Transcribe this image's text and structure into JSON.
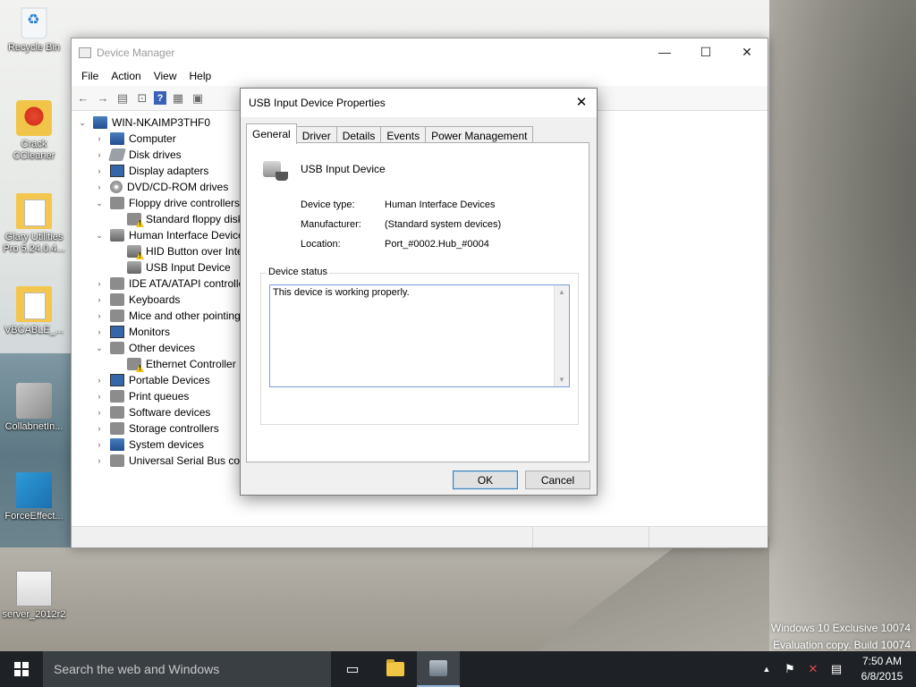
{
  "desktop": {
    "icons": [
      {
        "label": "Recycle Bin"
      },
      {
        "label": "Crack\nCCleaner"
      },
      {
        "label": "Glary Utilities\nPro 5.24.0.4..."
      },
      {
        "label": "VBCABLE_..."
      },
      {
        "label": "CollabnetIn..."
      },
      {
        "label": "ForceEffect..."
      },
      {
        "label": "server_2012r2"
      }
    ],
    "watermark": {
      "line1": "Windows 10 Exclusive 10074",
      "line2": "Evaluation copy. Build 10074"
    }
  },
  "device_manager": {
    "title": "Device Manager",
    "controls": {
      "minimize": "—",
      "maximize": "☐",
      "close": "✕"
    },
    "menu": [
      "File",
      "Action",
      "View",
      "Help"
    ],
    "toolbar": {
      "back_icon": "←",
      "forward_icon": "→",
      "props_icon": "▤",
      "scan_icon": "⊡",
      "help_icon": "?",
      "view_icon": "▦",
      "device_icon": "▣"
    },
    "tree": {
      "root": "WIN-NKAIMP3THF0",
      "items": [
        {
          "label": "Computer",
          "arrow": "›"
        },
        {
          "label": "Disk drives",
          "arrow": "›"
        },
        {
          "label": "Display adapters",
          "arrow": "›"
        },
        {
          "label": "DVD/CD-ROM drives",
          "arrow": "›"
        },
        {
          "label": "Floppy drive controllers",
          "arrow": "⌄"
        },
        {
          "label": "Standard floppy disk controller"
        },
        {
          "label": "Human Interface Devices",
          "arrow": "⌄"
        },
        {
          "label": "HID Button over Interrupt Driver"
        },
        {
          "label": "USB Input Device"
        },
        {
          "label": "IDE ATA/ATAPI controllers",
          "arrow": "›"
        },
        {
          "label": "Keyboards",
          "arrow": "›"
        },
        {
          "label": "Mice and other pointing devices",
          "arrow": "›"
        },
        {
          "label": "Monitors",
          "arrow": "›"
        },
        {
          "label": "Other devices",
          "arrow": "⌄"
        },
        {
          "label": "Ethernet Controller"
        },
        {
          "label": "Portable Devices",
          "arrow": "›"
        },
        {
          "label": "Print queues",
          "arrow": "›"
        },
        {
          "label": "Software devices",
          "arrow": "›"
        },
        {
          "label": "Storage controllers",
          "arrow": "›"
        },
        {
          "label": "System devices",
          "arrow": "›"
        },
        {
          "label": "Universal Serial Bus controllers",
          "arrow": "›"
        }
      ]
    }
  },
  "dialog": {
    "title": "USB Input Device Properties",
    "close": "✕",
    "tabs": [
      "General",
      "Driver",
      "Details",
      "Events",
      "Power Management"
    ],
    "device_name": "USB Input Device",
    "properties": [
      {
        "key": "Device type:",
        "value": "Human Interface Devices"
      },
      {
        "key": "Manufacturer:",
        "value": "(Standard system devices)"
      },
      {
        "key": "Location:",
        "value": "Port_#0002.Hub_#0004"
      }
    ],
    "status_legend": "Device status",
    "status_text": "This device is working properly.",
    "scroll_up": "▲",
    "scroll_down": "▼",
    "ok_label": "OK",
    "cancel_label": "Cancel"
  },
  "taskbar": {
    "search_placeholder": "Search the web and Windows",
    "task_view_icon": "▭",
    "tray": {
      "chevron": "▲",
      "network_icon": "⚑",
      "volume_icon": "✕",
      "action_center_icon": "▤"
    },
    "time": "7:50 AM",
    "date": "6/8/2015"
  }
}
